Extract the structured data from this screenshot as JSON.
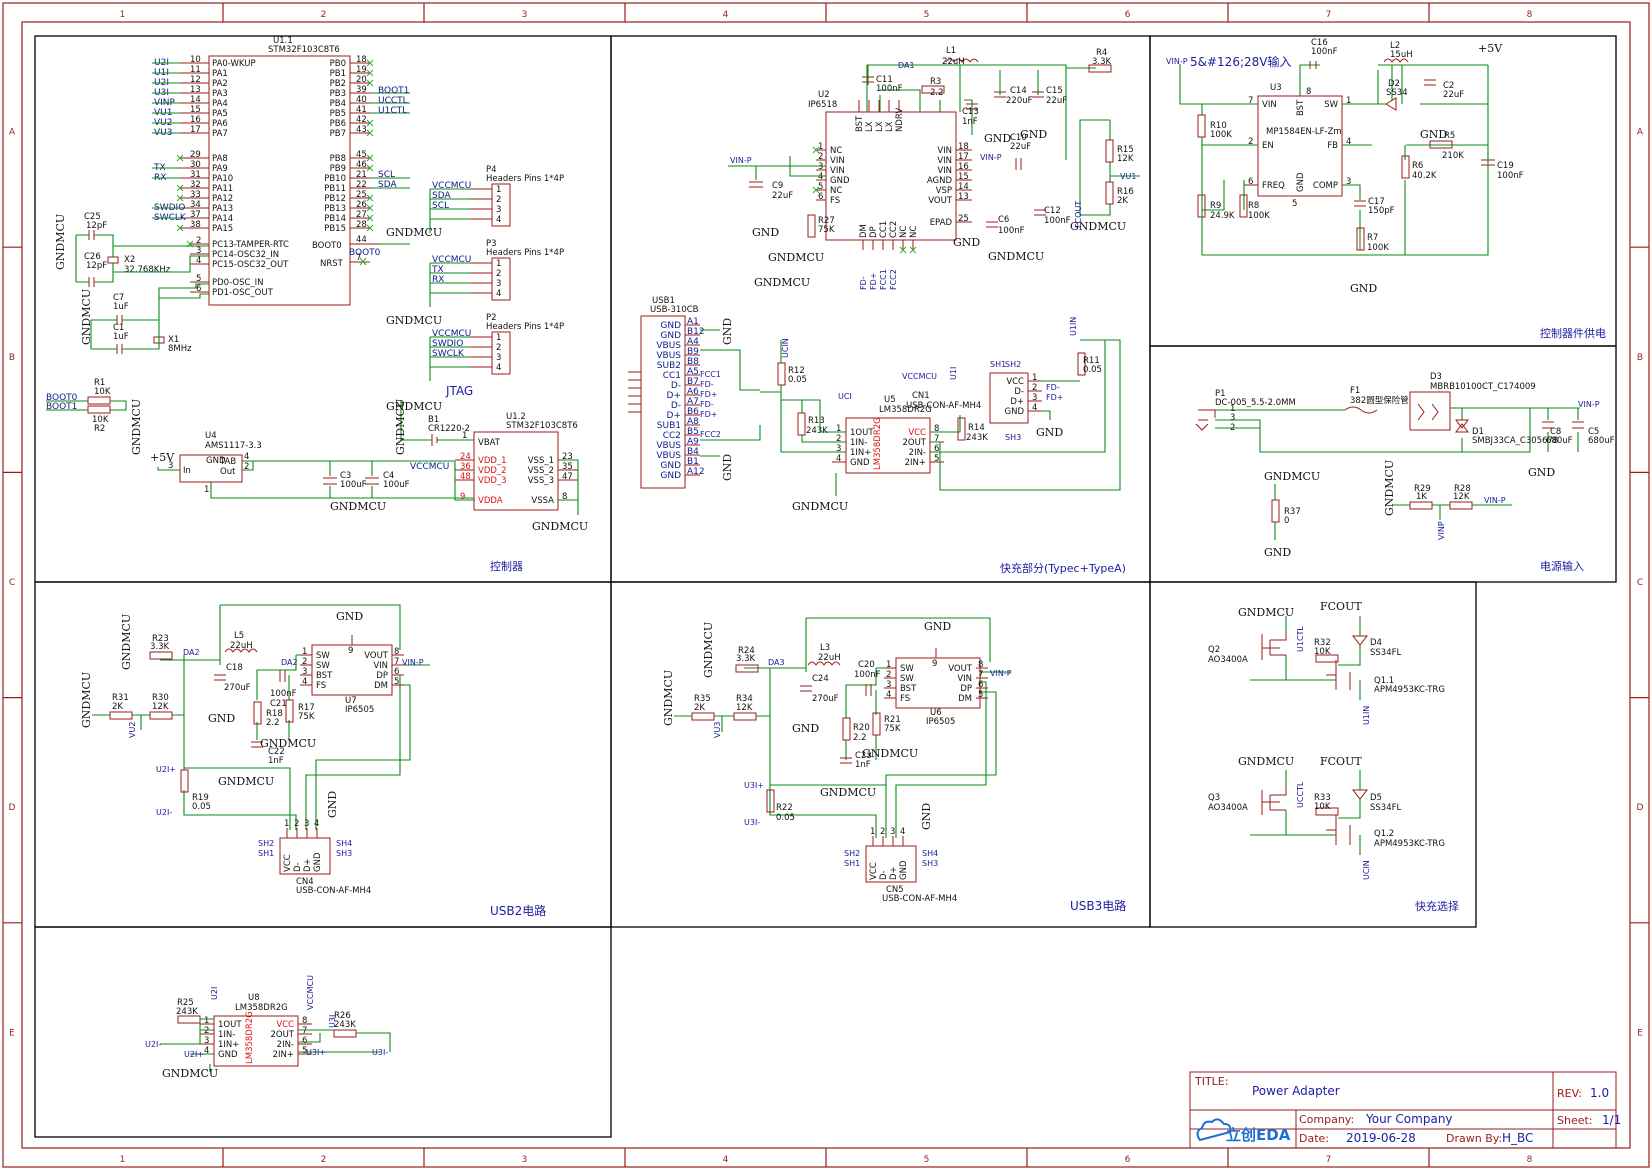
{
  "ruler": {
    "columns": [
      "1",
      "2",
      "3",
      "4",
      "5",
      "6",
      "7",
      "8"
    ],
    "rows": [
      "A",
      "B",
      "C",
      "D",
      "E"
    ]
  },
  "sections": {
    "controller": "控制器",
    "fast_charge": "快充部分(Typec+TypeA)",
    "controller_power": "控制器件供电",
    "power_input": "电源输入",
    "usb2": "USB2电路",
    "usb3": "USB3电路",
    "fast_select": "快充选择",
    "jtag": "JTAG"
  },
  "u1": {
    "ref": "U1.1",
    "part": "STM32F103C8T6",
    "left_pins": [
      {
        "net": "U2I",
        "num": "10",
        "name": "PA0-WKUP"
      },
      {
        "net": "U1I",
        "num": "11",
        "name": "PA1"
      },
      {
        "net": "U2I",
        "num": "12",
        "name": "PA2"
      },
      {
        "net": "U3I",
        "num": "13",
        "name": "PA3"
      },
      {
        "net": "VINP",
        "num": "14",
        "name": "PA4"
      },
      {
        "net": "VU1",
        "num": "15",
        "name": "PA5"
      },
      {
        "net": "VU2",
        "num": "16",
        "name": "PA6"
      },
      {
        "net": "VU3",
        "num": "17",
        "name": "PA7"
      },
      {
        "net": "",
        "num": "29",
        "name": "PA8"
      },
      {
        "net": "TX",
        "num": "30",
        "name": "PA9"
      },
      {
        "net": "RX",
        "num": "31",
        "name": "PA10"
      },
      {
        "net": "",
        "num": "32",
        "name": "PA11"
      },
      {
        "net": "",
        "num": "33",
        "name": "PA12"
      },
      {
        "net": "SWDIO",
        "num": "34",
        "name": "PA13"
      },
      {
        "net": "SWCLK",
        "num": "37",
        "name": "PA14"
      },
      {
        "net": "",
        "num": "38",
        "name": "PA15"
      }
    ],
    "osc_pins": [
      {
        "num": "2",
        "name": "PC13-TAMPER-RTC"
      },
      {
        "num": "3",
        "name": "PC14-OSC32_IN"
      },
      {
        "num": "4",
        "name": "PC15-OSC32_OUT"
      },
      {
        "num": "5",
        "name": "PD0-OSC_IN"
      },
      {
        "num": "6",
        "name": "PD1-OSC_OUT"
      }
    ],
    "right_pins": [
      {
        "name": "PB0",
        "num": "18",
        "net": ""
      },
      {
        "name": "PB1",
        "num": "19",
        "net": ""
      },
      {
        "name": "PB2",
        "num": "20",
        "net": ""
      },
      {
        "name": "PB3",
        "num": "39",
        "net": "BOOT1"
      },
      {
        "name": "PB4",
        "num": "40",
        "net": "UCCTL"
      },
      {
        "name": "PB5",
        "num": "41",
        "net": "U1CTL"
      },
      {
        "name": "PB6",
        "num": "42",
        "net": ""
      },
      {
        "name": "PB7",
        "num": "43",
        "net": ""
      },
      {
        "name": "PB8",
        "num": "45",
        "net": ""
      },
      {
        "name": "PB9",
        "num": "46",
        "net": ""
      },
      {
        "name": "PB10",
        "num": "21",
        "net": "SCL"
      },
      {
        "name": "PB11",
        "num": "22",
        "net": "SDA"
      },
      {
        "name": "PB12",
        "num": "25",
        "net": ""
      },
      {
        "name": "PB13",
        "num": "26",
        "net": ""
      },
      {
        "name": "PB14",
        "num": "27",
        "net": ""
      },
      {
        "name": "PB15",
        "num": "28",
        "net": ""
      }
    ],
    "boot0": {
      "name": "BOOT0",
      "num": "44",
      "net": "BOOT0"
    },
    "nrst": {
      "name": "NRST",
      "num": "7"
    }
  },
  "headers": [
    {
      "ref": "P4",
      "part": "Headers  Pins 1*4P",
      "nets": [
        "VCCMCU",
        "SDA",
        "SCL",
        ""
      ],
      "gnd": "GNDMCU"
    },
    {
      "ref": "P3",
      "part": "Headers  Pins 1*4P",
      "nets": [
        "VCCMCU",
        "TX",
        "RX",
        ""
      ],
      "gnd": "GNDMCU"
    },
    {
      "ref": "P2",
      "part": "Headers  Pins 1*4P",
      "nets": [
        "VCCMCU",
        "SWDIO",
        "SWCLK",
        ""
      ],
      "gnd": "GNDMCU"
    }
  ],
  "caps_ctrl": {
    "c25": [
      "C25",
      "12pF"
    ],
    "c26": [
      "C26",
      "12pF"
    ],
    "x2": [
      "X2",
      "32.768KHz"
    ],
    "c7": [
      "C7",
      "1uF"
    ],
    "c1": [
      "C1",
      "1uF"
    ],
    "x1": [
      "X1",
      "8MHz"
    ],
    "r1": [
      "R1",
      "10K"
    ],
    "r2": [
      "R2",
      "10K"
    ],
    "u4": [
      "U4",
      "AMS1117-3.3"
    ],
    "c3": [
      "C3",
      "100uF"
    ],
    "c4": [
      "C4",
      "100uF"
    ],
    "b1": [
      "B1",
      "CR1220-2"
    ]
  },
  "u12": {
    "ref": "U1.2",
    "part": "STM32F103C8T6",
    "left": [
      {
        "num": "24",
        "name": "VDD_1"
      },
      {
        "num": "36",
        "name": "VDD_2"
      },
      {
        "num": "48",
        "name": "VDD_3"
      },
      {
        "num": "9",
        "name": "VDDA"
      }
    ],
    "right": [
      {
        "num": "23",
        "name": "VSS_1"
      },
      {
        "num": "35",
        "name": "VSS_2"
      },
      {
        "num": "47",
        "name": "VSS_3"
      },
      {
        "num": "8",
        "name": "VSSA"
      }
    ],
    "vbat": {
      "num": "1",
      "name": "VBAT"
    }
  },
  "nets": {
    "gndmcu": "GNDMCU",
    "gnd": "GND",
    "vccmcu": "VCCMCU",
    "vinp": "VIN-P",
    "p5v": "+5V",
    "boot0": "BOOT0",
    "boot1": "BOOT1",
    "fcout": "FCOUT",
    "u1in": "U1IN",
    "ucin": "UCIN",
    "u1ctl": "U1CTL",
    "ucctl": "UCCTL",
    "vu1": "VU1",
    "vu2": "VU2",
    "vu3": "VU3",
    "vinp_lbl": "VINP",
    "da1": "DA1",
    "da2": "DA2",
    "da3": "DA3",
    "u2ip": "U2I+",
    "u2im": "U2I-",
    "u3ip": "U3I+",
    "u3im": "U3I-",
    "fcc1": "FCC1",
    "fcc2": "FCC2",
    "fdp": "FD+",
    "fdm": "FD-",
    "u1i": "U1I",
    "u2i": "U2I",
    "u3i": "U3I",
    "ucit": "UCI"
  },
  "ip6518": {
    "ref": "U2",
    "part": "IP6518",
    "left": [
      {
        "num": "1",
        "name": "NC"
      },
      {
        "num": "2",
        "name": "VIN"
      },
      {
        "num": "3",
        "name": "VIN"
      },
      {
        "num": "4",
        "name": "GND"
      },
      {
        "num": "5",
        "name": "NC"
      },
      {
        "num": "6",
        "name": "FS"
      }
    ],
    "top": [
      "BST",
      "LX",
      "LX",
      "LX",
      "NDRV"
    ],
    "right": [
      {
        "num": "18",
        "name": "VIN"
      },
      {
        "num": "17",
        "name": "VIN"
      },
      {
        "num": "16",
        "name": "VIN"
      },
      {
        "num": "15",
        "name": "AGND"
      },
      {
        "num": "14",
        "name": "VSP"
      },
      {
        "num": "13",
        "name": "VOUT"
      },
      {
        "num": "25",
        "name": "EPAD"
      }
    ],
    "bottom": [
      "DM",
      "DP",
      "CC1",
      "CC2",
      "NC",
      "NC"
    ]
  },
  "fc_parts": {
    "l1": [
      "L1",
      "22uH"
    ],
    "c11": [
      "C11",
      "100nF"
    ],
    "r3": [
      "R3",
      "2.2"
    ],
    "c13": [
      "C13",
      "1nF"
    ],
    "c14": [
      "C14",
      "220uF"
    ],
    "c15": [
      "C15",
      "22uF"
    ],
    "r4": [
      "R4",
      "3.3K"
    ],
    "c10": [
      "C10",
      "22uF"
    ],
    "r15": [
      "R15",
      "12K"
    ],
    "r16": [
      "R16",
      "2K"
    ],
    "c9": [
      "C9",
      "22uF"
    ],
    "r27": [
      "R27",
      "75K"
    ],
    "c6": [
      "C6",
      "100nF"
    ],
    "c12": [
      "C12",
      "100nF"
    ],
    "r12": [
      "R12",
      "0.05"
    ],
    "r13": [
      "R13",
      "243K"
    ],
    "r14": [
      "R14",
      "243K"
    ],
    "r11": [
      "R11",
      "0.05"
    ]
  },
  "usb1": {
    "ref": "USB1",
    "part": "USB-310CB",
    "pins": [
      [
        "GND",
        "A1"
      ],
      [
        "GND",
        "B12"
      ],
      [
        "VBUS",
        "A4"
      ],
      [
        "VBUS",
        "B9"
      ],
      [
        "SUB2",
        "B8"
      ],
      [
        "CC1",
        "A5"
      ],
      [
        "D-",
        "B7"
      ],
      [
        "D+",
        "A6"
      ],
      [
        "D-",
        "A7"
      ],
      [
        "D+",
        "B6"
      ],
      [
        "SUB1",
        "A8"
      ],
      [
        "CC2",
        "B5"
      ],
      [
        "VBUS",
        "A9"
      ],
      [
        "VBUS",
        "B4"
      ],
      [
        "GND",
        "B1"
      ],
      [
        "GND",
        "A12"
      ]
    ]
  },
  "u5": {
    "ref": "U5",
    "part": "LM358DR2G",
    "left": [
      "1OUT",
      "1IN-",
      "1IN+",
      "GND"
    ],
    "right": [
      "VCC",
      "2OUT",
      "2IN-",
      "2IN+"
    ]
  },
  "cn1": {
    "ref": "CN1",
    "part": "USB-CON-AF-MH4",
    "pins": [
      "VCC",
      "D-",
      "D+",
      "GND"
    ]
  },
  "mp1584": {
    "ref": "U3",
    "part": "MP1584EN-LF-Zm",
    "left": [
      {
        "num": "7",
        "name": "VIN"
      },
      {
        "num": "2",
        "name": "EN"
      },
      {
        "num": "6",
        "name": "FREQ"
      }
    ],
    "right": [
      {
        "num": "1",
        "name": "SW"
      },
      {
        "num": "4",
        "name": "FB"
      },
      {
        "num": "3",
        "name": "COMP"
      }
    ],
    "top": "BST",
    "bottom": "GND"
  },
  "cp_parts": {
    "note": "5&#126;28V输入",
    "c16": [
      "C16",
      "100nF"
    ],
    "l2": [
      "L2",
      "15uH"
    ],
    "d2": [
      "D2",
      "SS34"
    ],
    "c2": [
      "C2",
      "22uF"
    ],
    "r10": [
      "R10",
      "100K"
    ],
    "r9": [
      "R9",
      "24.9K"
    ],
    "r8": [
      "R8",
      "100K"
    ],
    "r6": [
      "R6",
      "40.2K"
    ],
    "r5": [
      "R5",
      "210K"
    ],
    "c19": [
      "C19",
      "100nF"
    ],
    "c17": [
      "C17",
      "150pF"
    ],
    "r7": [
      "R7",
      "100K"
    ]
  },
  "pin_parts": {
    "p1": [
      "P1",
      "DC-005_5.5-2.0MM"
    ],
    "f1": [
      "F1",
      "382圆型保险管"
    ],
    "d3": [
      "D3",
      "MBRB10100CT_C174009"
    ],
    "d1": [
      "D1",
      "SMBJ33CA_C305678"
    ],
    "c8": [
      "C8",
      "680uF"
    ],
    "c5": [
      "C5",
      "680uF"
    ],
    "r37": [
      "R37",
      "0"
    ],
    "r29": [
      "R29",
      "1K"
    ],
    "r28": [
      "R28",
      "12K"
    ]
  },
  "ip6505": {
    "left": [
      "SW",
      "SW",
      "BST",
      "FS"
    ],
    "right": [
      "VOUT",
      "VIN",
      "DP",
      "DM"
    ],
    "part": "IP6505"
  },
  "usb2": {
    "l5": [
      "L5",
      "22uH"
    ],
    "c18": [
      "C18",
      "270uF"
    ],
    "c21": [
      "C21",
      "100nF"
    ],
    "r23": [
      "R23",
      "3.3K"
    ],
    "r31": [
      "R31",
      "2K"
    ],
    "r30": [
      "R30",
      "12K"
    ],
    "r18": [
      "R18",
      "2.2"
    ],
    "c22": [
      "C22",
      "1nF"
    ],
    "r17": [
      "R17",
      "75K"
    ],
    "u7": "U7",
    "r19": [
      "R19",
      "0.05"
    ],
    "cn4": [
      "CN4",
      "USB-CON-AF-MH4"
    ]
  },
  "usb3": {
    "l3": [
      "L3",
      "22uH"
    ],
    "c24": [
      "C24",
      "270uF"
    ],
    "c20": [
      "C20",
      "100nF"
    ],
    "r24": [
      "R24",
      "3.3K"
    ],
    "r35": [
      "R35",
      "2K"
    ],
    "r34": [
      "R34",
      "12K"
    ],
    "r20": [
      "R20",
      "2.2"
    ],
    "c23": [
      "C23",
      "1nF"
    ],
    "r21": [
      "R21",
      "75K"
    ],
    "u6": "U6",
    "r22": [
      "R22",
      "0.05"
    ],
    "cn5": [
      "CN5",
      "USB-CON-AF-MH4"
    ]
  },
  "fsel": {
    "q2": [
      "Q2",
      "AO3400A"
    ],
    "r32": [
      "R32",
      "10K"
    ],
    "d4": [
      "D4",
      "SS34FL"
    ],
    "q11": [
      "Q1.1",
      "APM4953KC-TRG"
    ],
    "q3": [
      "Q3",
      "AO3400A"
    ],
    "r33": [
      "R33",
      "10K"
    ],
    "d5": [
      "D5",
      "SS34FL"
    ],
    "q12": [
      "Q1.2",
      "APM4953KC-TRG"
    ]
  },
  "u8": {
    "ref": "U8",
    "part": "LM358DR2G",
    "left": [
      "1OUT",
      "1IN-",
      "1IN+",
      "GND"
    ],
    "right": [
      "VCC",
      "2OUT",
      "2IN-",
      "2IN+"
    ],
    "r25": [
      "R25",
      "243K"
    ],
    "r26": [
      "R26",
      "243K"
    ]
  },
  "title_block": {
    "title_label": "TITLE:",
    "title": "Power Adapter",
    "rev_label": "REV:",
    "rev": "1.0",
    "company_label": "Company:",
    "company": "Your Company",
    "sheet_label": "Sheet:",
    "sheet": "1/1",
    "date_label": "Date:",
    "date": "2019-06-28",
    "drawn_label": "Drawn By:",
    "drawn": "H_BC",
    "logo": "立创EDA"
  }
}
